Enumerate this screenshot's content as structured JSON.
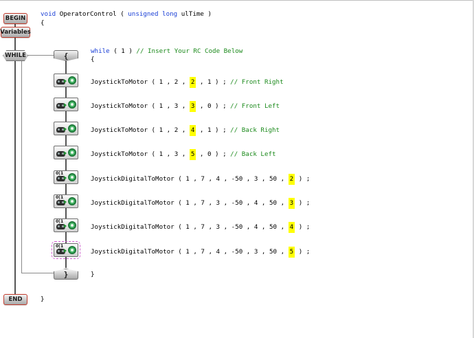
{
  "flow": {
    "begin": "BEGIN",
    "variables": "Variables",
    "while": "WHILE",
    "open_brace": "{",
    "close_brace": "}",
    "end": "END"
  },
  "code": {
    "signature_kw1": "void",
    "signature_name": "OperatorControl ( ",
    "signature_kw2": "unsigned long",
    "signature_arg": " ulTime )",
    "fn_open": "{",
    "while_kw": "while",
    "while_cond": " ( 1 ) ",
    "while_comment": "// Insert Your RC Code Below",
    "while_open": "{",
    "while_close": "}",
    "fn_close": "}",
    "statements": [
      {
        "pre": "JoystickToMotor ( 1 , 2 , ",
        "hl": "2",
        "post": " , 1 ) ; ",
        "comment": "// Front Right"
      },
      {
        "pre": "JoystickToMotor ( 1 , 3 , ",
        "hl": "3",
        "post": " , 0 ) ; ",
        "comment": "// Front Left"
      },
      {
        "pre": "JoystickToMotor ( 1 , 2 , ",
        "hl": "4",
        "post": " , 1 ) ; ",
        "comment": "// Back Right"
      },
      {
        "pre": "JoystickToMotor ( 1 , 3 , ",
        "hl": "5",
        "post": " , 0 ) ; ",
        "comment": "// Back Left"
      },
      {
        "pre": "JoystickDigitalToMotor ( 1 , 7 , 4 , -50 , 3 , 50 , ",
        "hl": "2",
        "post": " ) ;",
        "comment": ""
      },
      {
        "pre": "JoystickDigitalToMotor ( 1 , 7 , 3 , -50 , 4 , 50 , ",
        "hl": "3",
        "post": " ) ;",
        "comment": ""
      },
      {
        "pre": "JoystickDigitalToMotor ( 1 , 7 , 3 , -50 , 4 , 50 , ",
        "hl": "4",
        "post": " ) ;",
        "comment": ""
      },
      {
        "pre": "JoystickDigitalToMotor ( 1 , 7 , 4 , -50 , 3 , 50 , ",
        "hl": "5",
        "post": " ) ;",
        "comment": ""
      }
    ]
  },
  "block_icons": [
    {
      "type": "joystick-to-motor-icon",
      "label": ""
    },
    {
      "type": "joystick-to-motor-icon",
      "label": ""
    },
    {
      "type": "joystick-to-motor-icon",
      "label": ""
    },
    {
      "type": "joystick-to-motor-icon",
      "label": ""
    },
    {
      "type": "joystick-digital-to-motor-icon",
      "label": "0|1"
    },
    {
      "type": "joystick-digital-to-motor-icon",
      "label": "0|1"
    },
    {
      "type": "joystick-digital-to-motor-icon",
      "label": "0|1"
    },
    {
      "type": "joystick-digital-to-motor-icon",
      "label": "0|1"
    }
  ],
  "colors": {
    "keyword": "#1a3fd6",
    "comment": "#1c8a1c",
    "highlight": "#ffff00",
    "begin_end_border": "#c0392b",
    "selection": "#d05ad0"
  }
}
